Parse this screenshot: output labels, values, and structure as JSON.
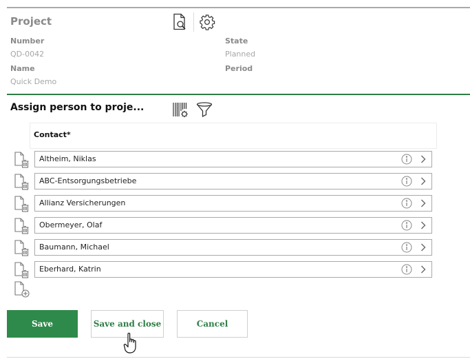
{
  "project": {
    "title": "Project",
    "number_label": "Number",
    "number_value": "QD-0042",
    "name_label": "Name",
    "name_value": "Quick Demo",
    "state_label": "State",
    "state_value": "Planned",
    "period_label": "Period",
    "period_value": ""
  },
  "assign": {
    "title": "Assign person to proje...",
    "column_header": "Contact*",
    "rows": [
      {
        "contact": "Altheim, Niklas"
      },
      {
        "contact": "ABC-Entsorgungsbetriebe"
      },
      {
        "contact": "Allianz Versicherungen"
      },
      {
        "contact": "Obermeyer, Olaf"
      },
      {
        "contact": "Baumann, Michael"
      },
      {
        "contact": "Eberhard, Katrin"
      }
    ]
  },
  "buttons": {
    "save": "Save",
    "save_close": "Save and close",
    "cancel": "Cancel"
  },
  "icons": {
    "document_search": "document-search-icon",
    "settings": "gear-icon",
    "barcode_settings": "barcode-settings-icon",
    "filter": "filter-icon",
    "delete_row": "document-delete-icon",
    "add_row": "document-add-icon",
    "info": "info-icon",
    "chevron": "chevron-right-icon",
    "cursor": "hand-pointer-icon"
  },
  "colors": {
    "accent": "#2e7d44",
    "primary_button": "#2e8a4a"
  }
}
